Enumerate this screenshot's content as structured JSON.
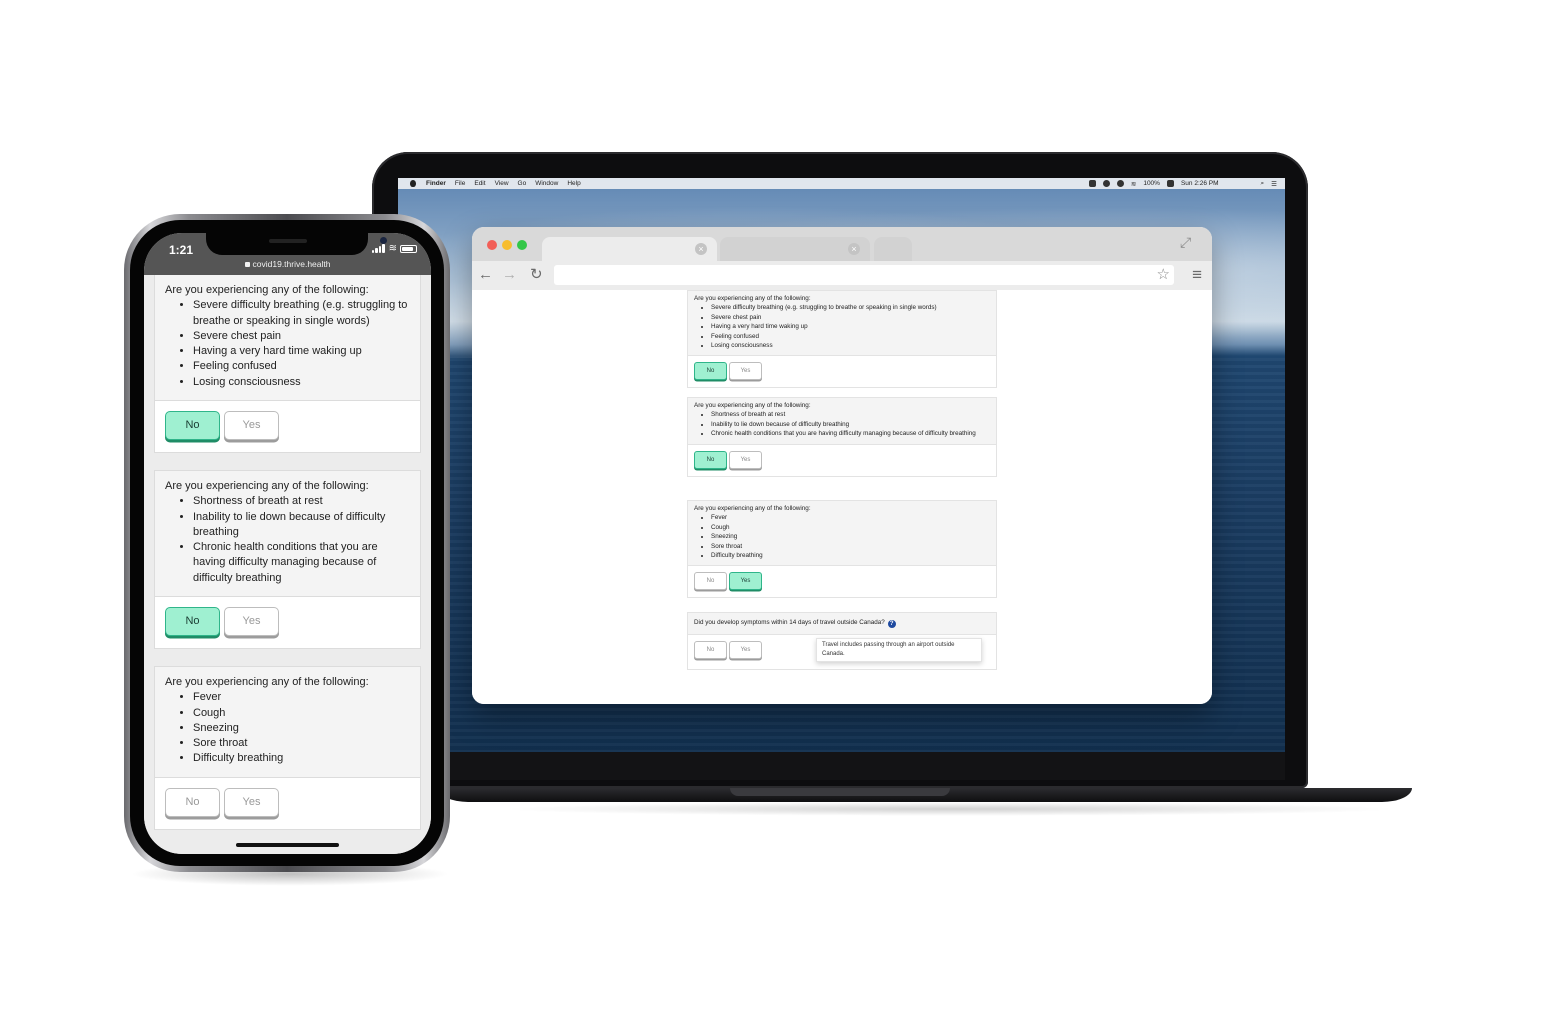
{
  "mac": {
    "menubar": {
      "items": [
        "Finder",
        "File",
        "Edit",
        "View",
        "Go",
        "Window",
        "Help"
      ],
      "battery": "100%",
      "clock": "Sun 2:26 PM"
    }
  },
  "browser": {
    "tab_close_glyph": "×",
    "star_glyph": "☆",
    "menu_glyph": "≡",
    "back_glyph": "←",
    "forward_glyph": "→",
    "reload_glyph": "↻",
    "expand_glyph": "⤢",
    "questions": [
      {
        "prompt": "Are you experiencing any of the following:",
        "items": [
          "Severe difficulty breathing (e.g. struggling to breathe or speaking in single words)",
          "Severe chest pain",
          "Having a very hard time waking up",
          "Feeling confused",
          "Losing consciousness"
        ],
        "no": "No",
        "yes": "Yes",
        "selected": "no"
      },
      {
        "prompt": "Are you experiencing any of the following:",
        "items": [
          "Shortness of breath at rest",
          "Inability to lie down because of difficulty breathing",
          "Chronic health conditions that you are having difficulty managing because of difficulty breathing"
        ],
        "no": "No",
        "yes": "Yes",
        "selected": "no"
      },
      {
        "prompt": "Are you experiencing any of the following:",
        "items": [
          "Fever",
          "Cough",
          "Sneezing",
          "Sore throat",
          "Difficulty breathing"
        ],
        "no": "No",
        "yes": "Yes",
        "selected": "yes"
      },
      {
        "prompt": "Did you develop symptoms within 14 days of travel outside Canada?",
        "help_glyph": "?",
        "tooltip": "Travel includes passing through an airport outside Canada.",
        "no": "No",
        "yes": "Yes",
        "selected": "none"
      }
    ]
  },
  "phone": {
    "time": "1:21",
    "url": "covid19.thrive.health",
    "wifi_glyph": "≋",
    "questions": [
      {
        "prompt": "Are you experiencing any of the following:",
        "items": [
          "Severe difficulty breathing (e.g. struggling to breathe or speaking in single words)",
          "Severe chest pain",
          "Having a very hard time waking up",
          "Feeling confused",
          "Losing consciousness"
        ],
        "no": "No",
        "yes": "Yes",
        "selected": "no"
      },
      {
        "prompt": "Are you experiencing any of the following:",
        "items": [
          "Shortness of breath at rest",
          "Inability to lie down because of difficulty breathing",
          "Chronic health conditions that you are having difficulty managing because of difficulty breathing"
        ],
        "no": "No",
        "yes": "Yes",
        "selected": "no"
      },
      {
        "prompt": "Are you experiencing any of the following:",
        "items": [
          "Fever",
          "Cough",
          "Sneezing",
          "Sore throat",
          "Difficulty breathing"
        ],
        "no": "No",
        "yes": "Yes",
        "selected": "none"
      }
    ]
  },
  "colors": {
    "selected_fill": "#9ff0d1",
    "selected_border": "#2fb58a",
    "help_icon": "#1f4aa0",
    "phone_status_bar": "#555555"
  }
}
